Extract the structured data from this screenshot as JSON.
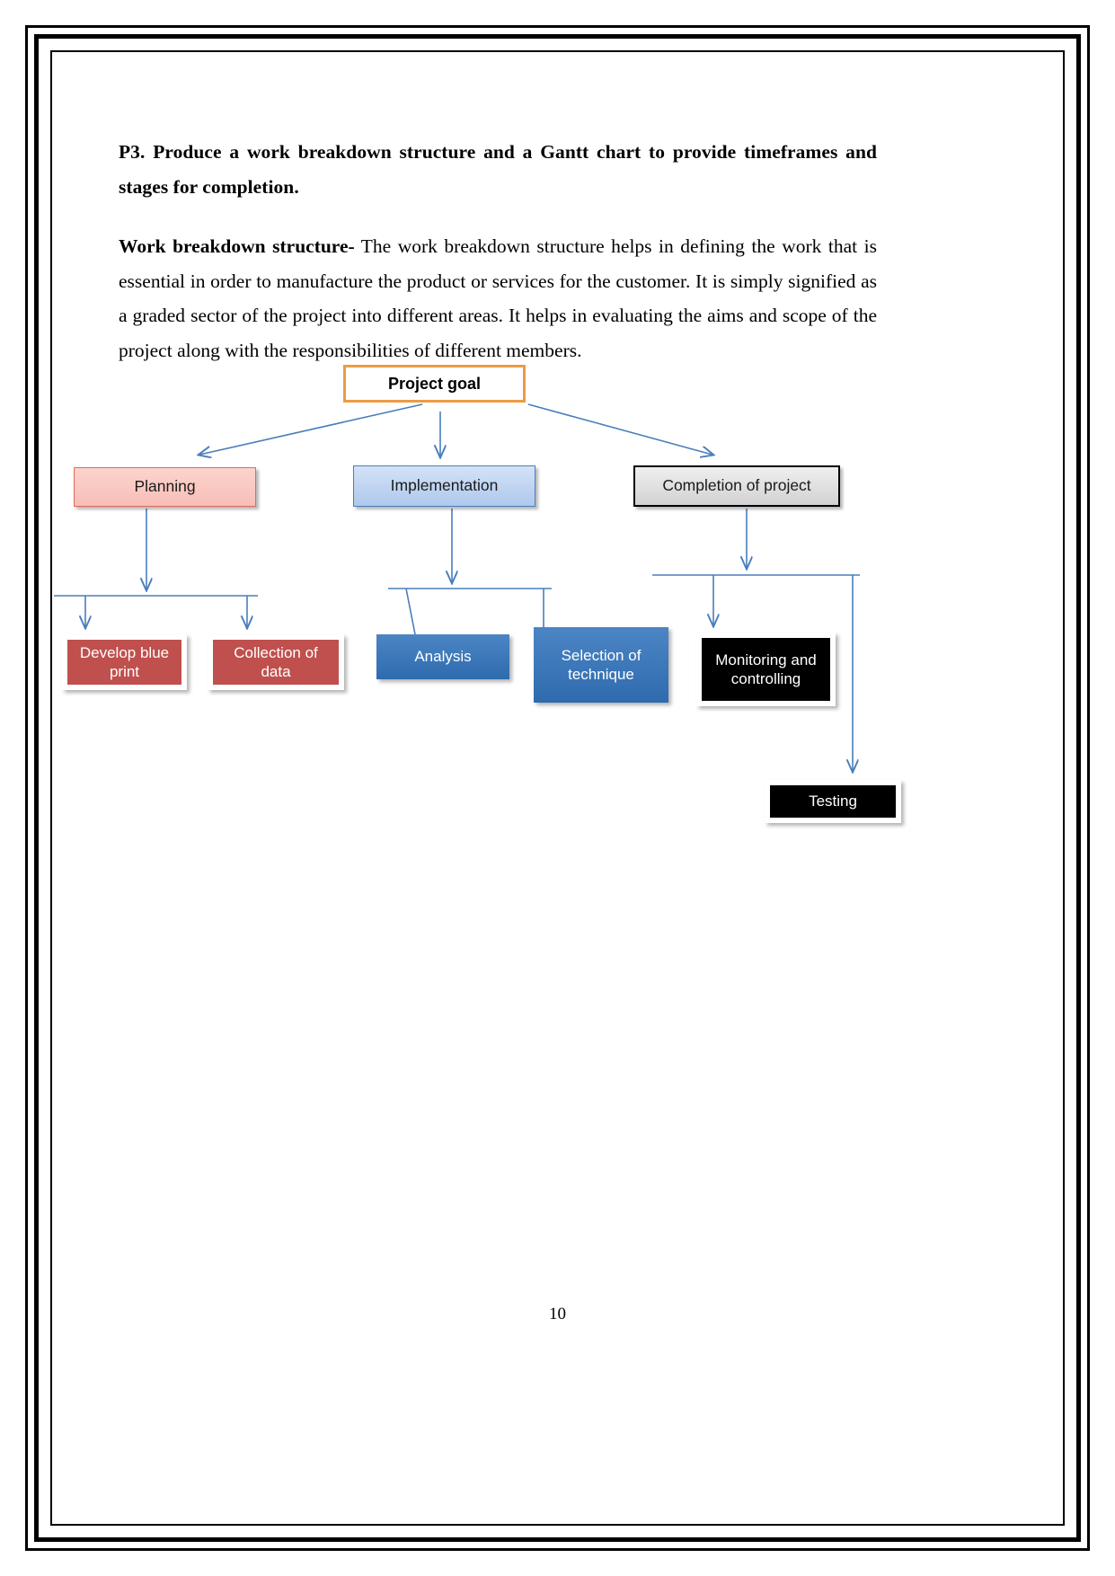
{
  "page": {
    "number": "10"
  },
  "heading": {
    "text": "P3. Produce a work breakdown structure and a Gantt chart to provide timeframes and stages for completion."
  },
  "paragraph": {
    "lead": "Work breakdown structure-",
    "body": " The work breakdown structure helps in defining the work that is essential in order to manufacture the product or services for the customer. It is simply signified as a graded sector of the project into different areas. It helps in evaluating the aims and scope of the project along with the responsibilities of different members."
  },
  "diagram": {
    "title": "work-breakdown-structure",
    "colors": {
      "root_border": "#ED9B44",
      "planning_fill": "#F8BEB7",
      "planning_border": "#E06A5C",
      "implementation_fill": "#AEC8EC",
      "implementation_border": "#4A7EBB",
      "completion_fill": "#D2D2D2",
      "completion_border": "#000000",
      "red_fill": "#C0504D",
      "blue_fill": "#2E6BAE",
      "black_fill": "#000000",
      "connector": "#4A7EBB"
    },
    "nodes": {
      "root": "Project goal",
      "planning": "Planning",
      "implementation": "Implementation",
      "completion": "Completion of project",
      "develop_blue_print": "Develop blue print",
      "collection_of_data": "Collection of data",
      "analysis": "Analysis",
      "selection_of_technique": "Selection of technique",
      "monitoring_and_controlling": "Monitoring and controlling",
      "testing": "Testing"
    }
  }
}
